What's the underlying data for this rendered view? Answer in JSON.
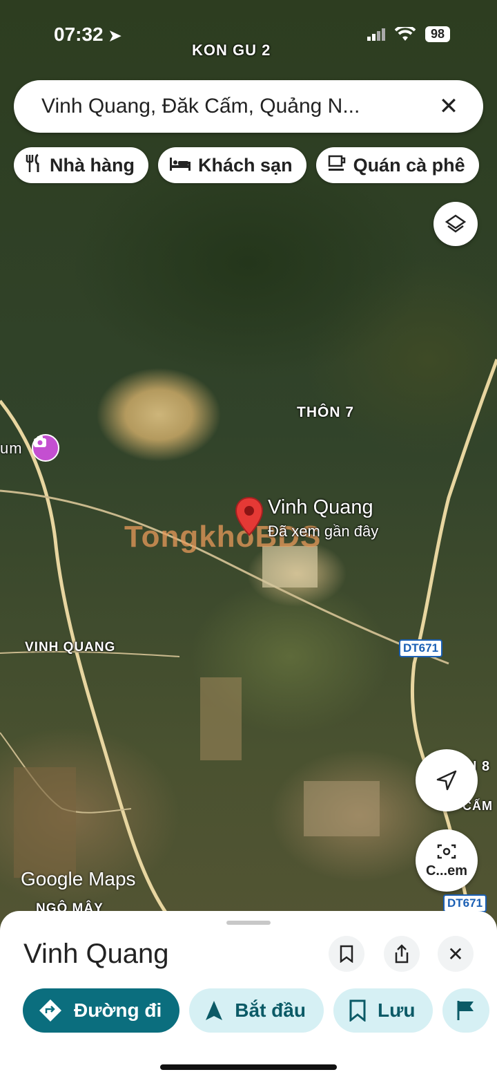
{
  "status_bar": {
    "time": "07:32",
    "battery": "98"
  },
  "map_labels": {
    "kon_gu": "KON GU 2",
    "thon7": "THÔN 7",
    "vinh_quang": "VINH QUANG",
    "ngo_may": "NGÔ MÂY",
    "thon8": "N 8",
    "dak_cam": "CẤM",
    "museum": "um",
    "google": "Google Maps",
    "road1": "DT671",
    "road2": "DT671"
  },
  "search": {
    "value": "Vinh Quang, Đăk Cấm, Quảng N..."
  },
  "chips": [
    {
      "label": "Nhà hàng",
      "icon": "restaurant-icon"
    },
    {
      "label": "Khách sạn",
      "icon": "hotel-icon"
    },
    {
      "label": "Quán cà phê",
      "icon": "coffee-icon"
    }
  ],
  "pin": {
    "title": "Vinh Quang",
    "subtitle": "Đã xem gần đây"
  },
  "watermark": "TongkhoBDS",
  "fab_camera_label": "C...em",
  "sheet": {
    "title": "Vinh Quang",
    "actions": [
      {
        "label": "Đường đi",
        "icon": "directions-icon"
      },
      {
        "label": "Bắt đầu",
        "icon": "navigation-arrow-icon"
      },
      {
        "label": "Lưu",
        "icon": "bookmark-icon"
      }
    ]
  },
  "colors": {
    "primary": "#0b6e7e",
    "secondary": "#d6f0f4",
    "pin": "#e53935"
  }
}
